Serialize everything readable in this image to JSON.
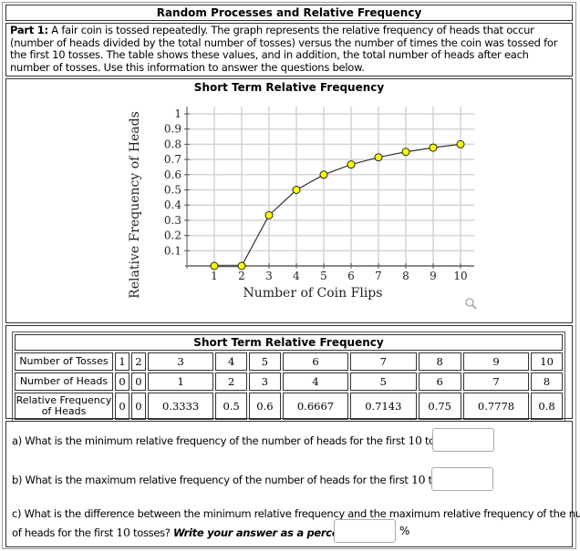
{
  "page": {
    "title": "Random Processes and Relative Frequency",
    "intro_bold": "Part 1:",
    "intro_text": " A fair coin is tossed repeatedly. The graph represents the relative frequency of heads that occur (number of heads divided by the total number of tosses) versus the number of times the coin was tossed for the first 10 tosses. The table shows these values, and in addition, the total number of heads after each number of tosses. Use this information to answer the questions below."
  },
  "chart_data": {
    "type": "line",
    "title": "Short Term Relative Frequency",
    "xlabel": "Number of Coin Flips",
    "ylabel": "Relative Frequency of Heads",
    "x": [
      1,
      2,
      3,
      4,
      5,
      6,
      7,
      8,
      9,
      10
    ],
    "series": [
      {
        "name": "Relative Frequency of Heads",
        "values": [
          0,
          0,
          0.3333,
          0.5,
          0.6,
          0.6667,
          0.7143,
          0.75,
          0.7778,
          0.8
        ]
      }
    ],
    "xticks": [
      "1",
      "2",
      "3",
      "4",
      "5",
      "6",
      "7",
      "8",
      "9",
      "10"
    ],
    "yticks": [
      "0.1",
      "0.2",
      "0.3",
      "0.4",
      "0.5",
      "0.6",
      "0.7",
      "0.8",
      "0.9",
      "1"
    ],
    "xlim": [
      0,
      10.5
    ],
    "ylim": [
      0,
      1
    ],
    "grid": true,
    "marker_color": "#ffff00",
    "line_color": "#333333"
  },
  "chart_tools": {
    "zoom_icon": "magnifier-icon"
  },
  "table": {
    "title": "Short Term Relative Frequency",
    "rows": [
      {
        "label": "Number of Tosses",
        "values": [
          "1",
          "2",
          "3",
          "4",
          "5",
          "6",
          "7",
          "8",
          "9",
          "10"
        ]
      },
      {
        "label": "Number of Heads",
        "values": [
          "0",
          "0",
          "1",
          "2",
          "3",
          "4",
          "5",
          "6",
          "7",
          "8"
        ]
      },
      {
        "label": "Relative Frequency of Heads",
        "values": [
          "0",
          "0",
          "0.3333",
          "0.5",
          "0.6",
          "0.6667",
          "0.7143",
          "0.75",
          "0.7778",
          "0.8"
        ]
      }
    ]
  },
  "questions": {
    "a": {
      "pre": "a) What is the minimum relative frequency of the number of heads for the first ",
      "num": "10",
      "post": " tosses?",
      "value": ""
    },
    "b": {
      "pre": "b) What is the maximum relative frequency of the number of heads for the first ",
      "num": "10",
      "post": " tosses?",
      "value": ""
    },
    "c": {
      "line1": "c) What is the difference between the minimum relative frequency and the maximum relative frequency of the number",
      "pre": "of heads for the first ",
      "num": "10",
      "post": " tosses? ",
      "emph": "Write your answer as a percent.",
      "unit": "%",
      "value": ""
    }
  }
}
